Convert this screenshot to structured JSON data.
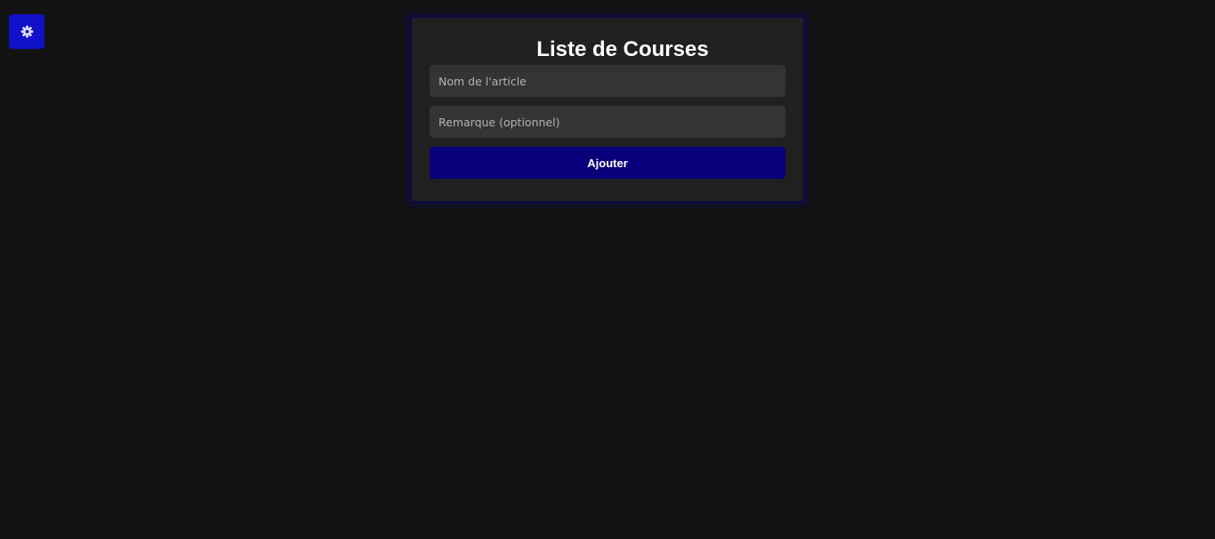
{
  "settings": {
    "icon": "gear-icon",
    "color": "#1010c8"
  },
  "form": {
    "title": "Liste de Courses",
    "item_name": {
      "placeholder": "Nom de l'article",
      "value": ""
    },
    "note": {
      "placeholder": "Remarque (optionnel)",
      "value": ""
    },
    "submit_label": "Ajouter",
    "submit_color": "#07007a"
  },
  "theme": {
    "background": "#121212",
    "card_background": "#202020",
    "input_background": "#343434"
  }
}
